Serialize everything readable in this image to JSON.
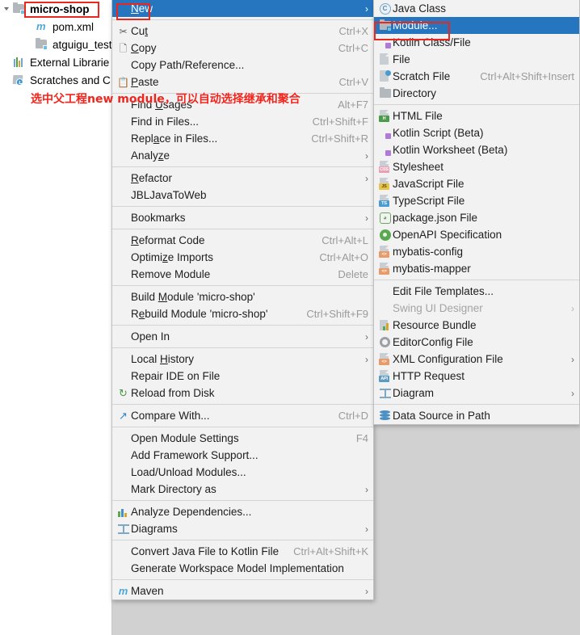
{
  "tree": {
    "items": [
      {
        "label": "micro-shop",
        "icon": "module-icon",
        "bold": true,
        "indent": 0,
        "twisty": "chevron-down-icon",
        "type": "module"
      },
      {
        "label": "pom.xml",
        "icon": "maven-icon",
        "bold": false,
        "indent": 2,
        "twisty": "",
        "type": "maven"
      },
      {
        "label": "atguigu_test.i",
        "icon": "module-icon",
        "bold": false,
        "indent": 2,
        "twisty": "",
        "type": "module"
      },
      {
        "label": "External Librarie",
        "icon": "library-icon",
        "bold": false,
        "indent": 0,
        "twisty": "",
        "type": "library"
      },
      {
        "label": "Scratches and C",
        "icon": "scratches-icon",
        "bold": false,
        "indent": 0,
        "twisty": "",
        "type": "scratch"
      }
    ]
  },
  "annotation": {
    "text": "选中父工程new module，可以自动选择继承和聚合",
    "color": "#f2231b"
  },
  "context_menu": {
    "items": [
      {
        "type": "item",
        "label": "New",
        "mnemonic": "N",
        "shortcut": "",
        "icon": "",
        "arrow": true,
        "selected": true
      },
      {
        "type": "sep"
      },
      {
        "type": "item",
        "label": "Cut",
        "mnemonic": "t",
        "shortcut": "Ctrl+X",
        "icon": "cut-icon",
        "arrow": false
      },
      {
        "type": "item",
        "label": "Copy",
        "mnemonic": "C",
        "shortcut": "Ctrl+C",
        "icon": "copy-icon",
        "arrow": false
      },
      {
        "type": "item",
        "label": "Copy Path/Reference...",
        "mnemonic": "",
        "shortcut": "",
        "icon": "",
        "arrow": false
      },
      {
        "type": "item",
        "label": "Paste",
        "mnemonic": "P",
        "shortcut": "Ctrl+V",
        "icon": "paste-icon",
        "arrow": false
      },
      {
        "type": "sep"
      },
      {
        "type": "item",
        "label": "Find Usages",
        "mnemonic": "U",
        "shortcut": "Alt+F7",
        "icon": "",
        "arrow": false
      },
      {
        "type": "item",
        "label": "Find in Files...",
        "mnemonic": "",
        "shortcut": "Ctrl+Shift+F",
        "icon": "",
        "arrow": false
      },
      {
        "type": "item",
        "label": "Replace in Files...",
        "mnemonic": "a",
        "shortcut": "Ctrl+Shift+R",
        "icon": "",
        "arrow": false
      },
      {
        "type": "item",
        "label": "Analyze",
        "mnemonic": "z",
        "shortcut": "",
        "icon": "",
        "arrow": true
      },
      {
        "type": "sep"
      },
      {
        "type": "item",
        "label": "Refactor",
        "mnemonic": "R",
        "shortcut": "",
        "icon": "",
        "arrow": true
      },
      {
        "type": "item",
        "label": "JBLJavaToWeb",
        "mnemonic": "",
        "shortcut": "",
        "icon": "",
        "arrow": false
      },
      {
        "type": "sep"
      },
      {
        "type": "item",
        "label": "Bookmarks",
        "mnemonic": "",
        "shortcut": "",
        "icon": "",
        "arrow": true
      },
      {
        "type": "sep"
      },
      {
        "type": "item",
        "label": "Reformat Code",
        "mnemonic": "R",
        "shortcut": "Ctrl+Alt+L",
        "icon": "",
        "arrow": false
      },
      {
        "type": "item",
        "label": "Optimize Imports",
        "mnemonic": "z",
        "shortcut": "Ctrl+Alt+O",
        "icon": "",
        "arrow": false
      },
      {
        "type": "item",
        "label": "Remove Module",
        "mnemonic": "",
        "shortcut": "Delete",
        "icon": "",
        "arrow": false
      },
      {
        "type": "sep"
      },
      {
        "type": "item",
        "label": "Build Module 'micro-shop'",
        "mnemonic": "M",
        "shortcut": "",
        "icon": "",
        "arrow": false
      },
      {
        "type": "item",
        "label": "Rebuild Module 'micro-shop'",
        "mnemonic": "e",
        "shortcut": "Ctrl+Shift+F9",
        "icon": "",
        "arrow": false
      },
      {
        "type": "sep"
      },
      {
        "type": "item",
        "label": "Open In",
        "mnemonic": "",
        "shortcut": "",
        "icon": "",
        "arrow": true
      },
      {
        "type": "sep"
      },
      {
        "type": "item",
        "label": "Local History",
        "mnemonic": "H",
        "shortcut": "",
        "icon": "",
        "arrow": true
      },
      {
        "type": "item",
        "label": "Repair IDE on File",
        "mnemonic": "",
        "shortcut": "",
        "icon": "",
        "arrow": false
      },
      {
        "type": "item",
        "label": "Reload from Disk",
        "mnemonic": "",
        "shortcut": "",
        "icon": "reload-icon",
        "arrow": false
      },
      {
        "type": "sep"
      },
      {
        "type": "item",
        "label": "Compare With...",
        "mnemonic": "",
        "shortcut": "Ctrl+D",
        "icon": "compare-icon",
        "arrow": false
      },
      {
        "type": "sep"
      },
      {
        "type": "item",
        "label": "Open Module Settings",
        "mnemonic": "",
        "shortcut": "F4",
        "icon": "",
        "arrow": false
      },
      {
        "type": "item",
        "label": "Add Framework Support...",
        "mnemonic": "",
        "shortcut": "",
        "icon": "",
        "arrow": false
      },
      {
        "type": "item",
        "label": "Load/Unload Modules...",
        "mnemonic": "",
        "shortcut": "",
        "icon": "",
        "arrow": false
      },
      {
        "type": "item",
        "label": "Mark Directory as",
        "mnemonic": "",
        "shortcut": "",
        "icon": "",
        "arrow": true
      },
      {
        "type": "sep"
      },
      {
        "type": "item",
        "label": "Analyze Dependencies...",
        "mnemonic": "",
        "shortcut": "",
        "icon": "analyze-dependencies-icon",
        "arrow": false
      },
      {
        "type": "item",
        "label": "Diagrams",
        "mnemonic": "",
        "shortcut": "",
        "icon": "diagram-icon",
        "arrow": true
      },
      {
        "type": "sep"
      },
      {
        "type": "item",
        "label": "Convert Java File to Kotlin File",
        "mnemonic": "",
        "shortcut": "Ctrl+Alt+Shift+K",
        "icon": "",
        "arrow": false
      },
      {
        "type": "item",
        "label": "Generate Workspace Model Implementation",
        "mnemonic": "",
        "shortcut": "",
        "icon": "",
        "arrow": false
      },
      {
        "type": "sep"
      },
      {
        "type": "item",
        "label": "Maven",
        "mnemonic": "",
        "shortcut": "",
        "icon": "maven-icon",
        "arrow": true
      }
    ]
  },
  "new_submenu": {
    "items": [
      {
        "type": "item",
        "label": "Java Class",
        "shortcut": "",
        "icon": "java-class-icon",
        "arrow": false
      },
      {
        "type": "item",
        "label": "Module...",
        "shortcut": "",
        "icon": "module-icon",
        "arrow": false,
        "selected": true
      },
      {
        "type": "item",
        "label": "Kotlin Class/File",
        "shortcut": "",
        "icon": "kotlin-file-icon",
        "arrow": false
      },
      {
        "type": "item",
        "label": "File",
        "shortcut": "",
        "icon": "file-icon",
        "arrow": false
      },
      {
        "type": "item",
        "label": "Scratch File",
        "shortcut": "Ctrl+Alt+Shift+Insert",
        "icon": "scratch-file-icon",
        "arrow": false
      },
      {
        "type": "item",
        "label": "Directory",
        "shortcut": "",
        "icon": "directory-icon",
        "arrow": false
      },
      {
        "type": "sep"
      },
      {
        "type": "item",
        "label": "HTML File",
        "shortcut": "",
        "icon": "html-file-icon",
        "arrow": false
      },
      {
        "type": "item",
        "label": "Kotlin Script (Beta)",
        "shortcut": "",
        "icon": "kotlin-file-icon",
        "arrow": false
      },
      {
        "type": "item",
        "label": "Kotlin Worksheet (Beta)",
        "shortcut": "",
        "icon": "kotlin-file-icon",
        "arrow": false
      },
      {
        "type": "item",
        "label": "Stylesheet",
        "shortcut": "",
        "icon": "css-file-icon",
        "arrow": false
      },
      {
        "type": "item",
        "label": "JavaScript File",
        "shortcut": "",
        "icon": "javascript-file-icon",
        "arrow": false
      },
      {
        "type": "item",
        "label": "TypeScript File",
        "shortcut": "",
        "icon": "typescript-file-icon",
        "arrow": false
      },
      {
        "type": "item",
        "label": "package.json File",
        "shortcut": "",
        "icon": "nodejs-icon",
        "arrow": false
      },
      {
        "type": "item",
        "label": "OpenAPI Specification",
        "shortcut": "",
        "icon": "openapi-icon",
        "arrow": false
      },
      {
        "type": "item",
        "label": "mybatis-config",
        "shortcut": "",
        "icon": "xml-file-icon",
        "arrow": false
      },
      {
        "type": "item",
        "label": "mybatis-mapper",
        "shortcut": "",
        "icon": "xml-file-icon",
        "arrow": false
      },
      {
        "type": "sep"
      },
      {
        "type": "item",
        "label": "Edit File Templates...",
        "shortcut": "",
        "icon": "",
        "arrow": false
      },
      {
        "type": "item",
        "label": "Swing UI Designer",
        "shortcut": "",
        "icon": "",
        "arrow": true,
        "disabled": true
      },
      {
        "type": "item",
        "label": "Resource Bundle",
        "shortcut": "",
        "icon": "resource-bundle-icon",
        "arrow": false
      },
      {
        "type": "item",
        "label": "EditorConfig File",
        "shortcut": "",
        "icon": "gear-icon",
        "arrow": false
      },
      {
        "type": "item",
        "label": "XML Configuration File",
        "shortcut": "",
        "icon": "xml-file-icon",
        "arrow": true
      },
      {
        "type": "item",
        "label": "HTTP Request",
        "shortcut": "",
        "icon": "http-request-icon",
        "arrow": false
      },
      {
        "type": "item",
        "label": "Diagram",
        "shortcut": "",
        "icon": "diagram-icon",
        "arrow": true
      },
      {
        "type": "sep"
      },
      {
        "type": "item",
        "label": "Data Source in Path",
        "shortcut": "",
        "icon": "database-icon",
        "arrow": false
      }
    ]
  },
  "colors": {
    "selection": "#2675bf",
    "menu_bg": "#f2f2f2",
    "annotation_red": "#e8271f",
    "desktop_bg": "#d1d1d1"
  }
}
